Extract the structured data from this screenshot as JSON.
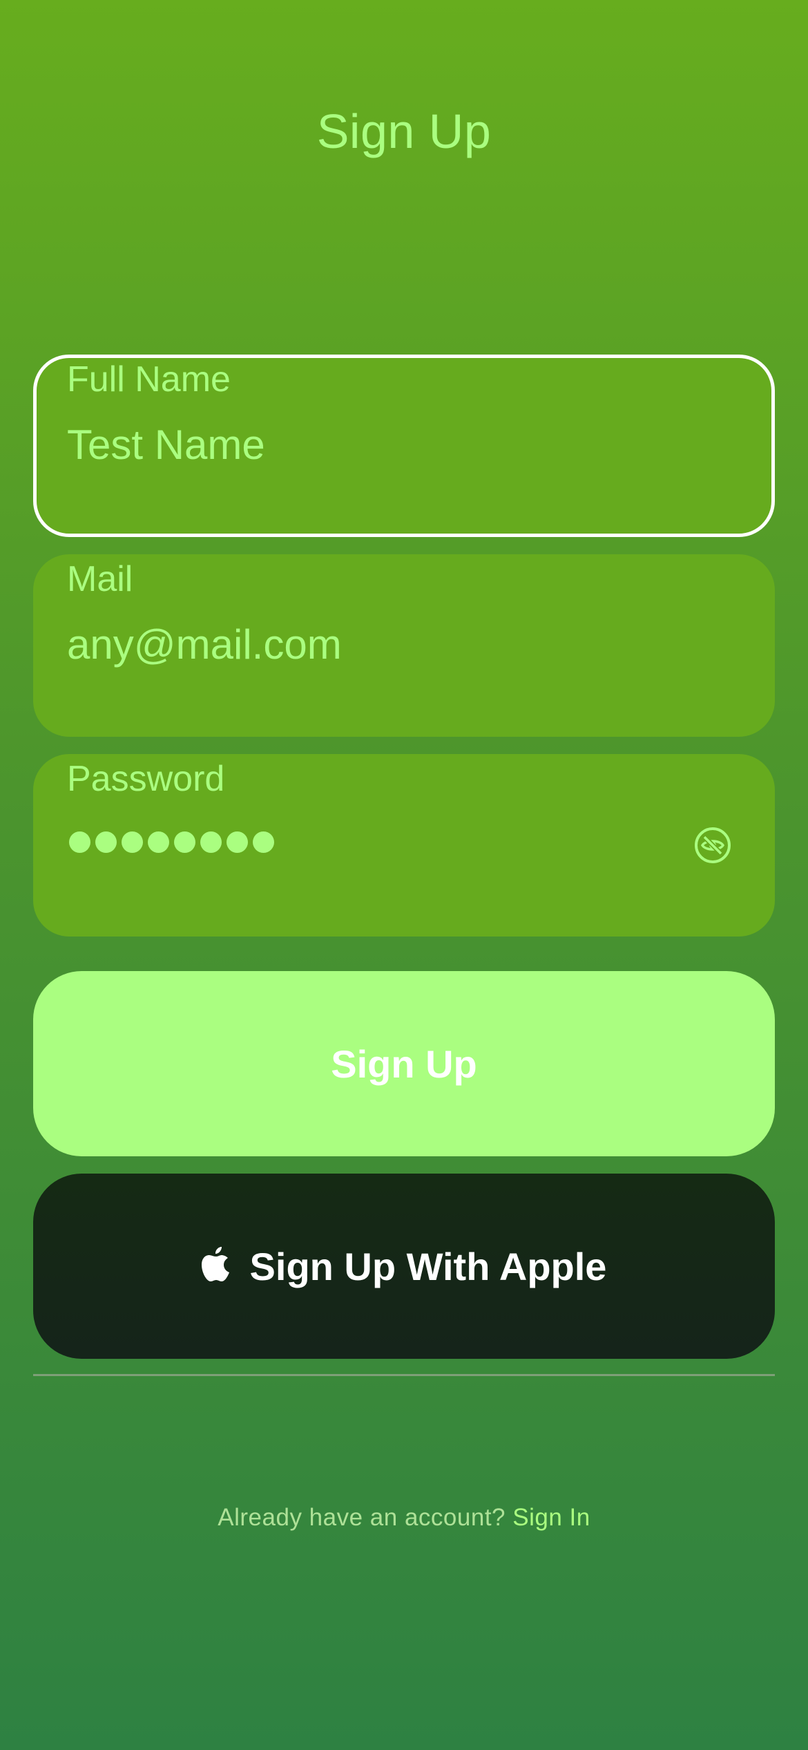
{
  "header": {
    "title": "Sign Up"
  },
  "form": {
    "full_name": {
      "label": "Full Name",
      "value": "Test Name"
    },
    "mail": {
      "label": "Mail",
      "value": "any@mail.com"
    },
    "password": {
      "label": "Password",
      "masked_value": "••••••••",
      "visibility_icon": "eye-slash-icon"
    }
  },
  "actions": {
    "sign_up_label": "Sign Up",
    "apple_label": "Sign Up With Apple",
    "apple_icon": "apple-logo-icon"
  },
  "footer": {
    "prompt": "Already have an account?",
    "link_label": "Sign In"
  },
  "colors": {
    "accent": "#aafe80",
    "field_background": "#66ab1e",
    "apple_button": "#15271a"
  }
}
